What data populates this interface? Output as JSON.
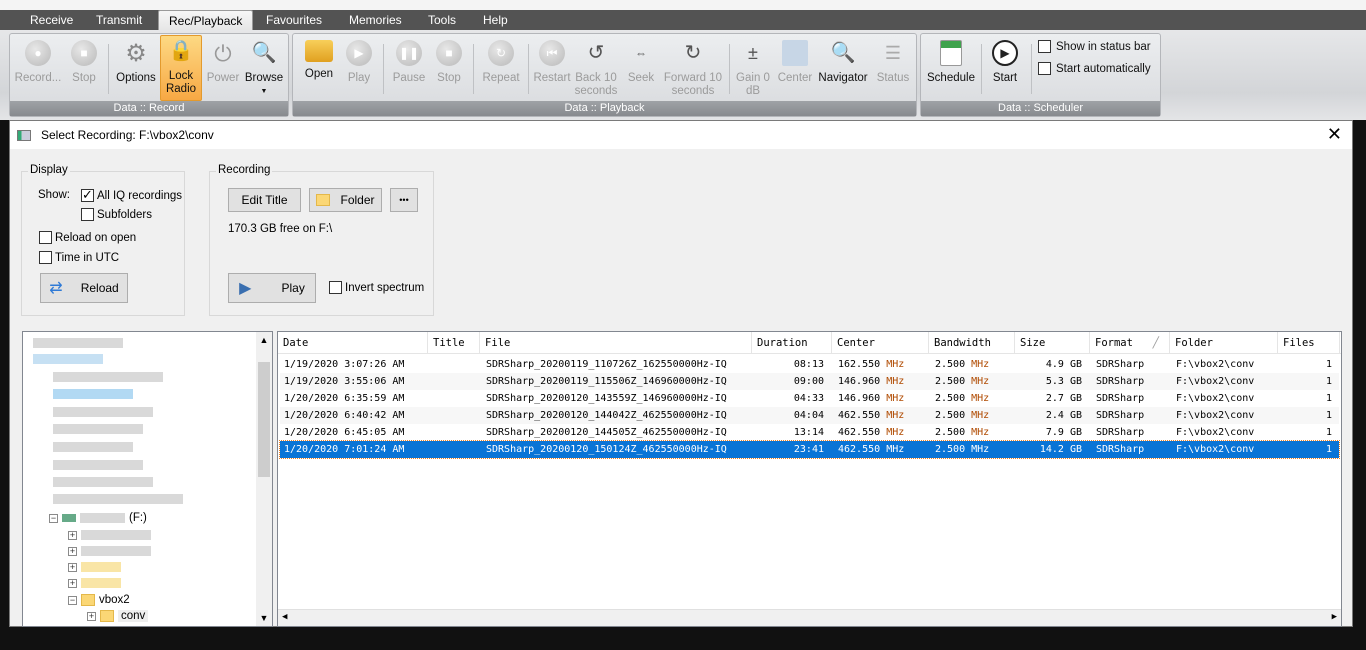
{
  "menu": {
    "tabs": [
      {
        "label": "Receive"
      },
      {
        "label": "Transmit"
      },
      {
        "label": "Rec/Playback",
        "active": true
      },
      {
        "label": "Favourites"
      },
      {
        "label": "Memories"
      },
      {
        "label": "Tools"
      },
      {
        "label": "Help"
      }
    ]
  },
  "ribbon": {
    "record_group": {
      "label": "Data :: Record",
      "buttons": [
        {
          "label": "Record...",
          "icon": "record-icon",
          "enabled": false
        },
        {
          "label": "Stop",
          "icon": "stop-icon",
          "enabled": false
        },
        {
          "label": "Options",
          "icon": "gear-icon",
          "enabled": true
        },
        {
          "label": "Lock Radio",
          "icon": "lock-icon",
          "enabled": true,
          "highlighted": true
        },
        {
          "label": "Power",
          "icon": "power-icon",
          "enabled": false
        },
        {
          "label": "Browse",
          "icon": "browse-icon",
          "enabled": true
        }
      ]
    },
    "playback_group": {
      "label": "Data :: Playback",
      "buttons": [
        {
          "label": "Open",
          "icon": "folder-icon",
          "enabled": true
        },
        {
          "label": "Play",
          "icon": "play-icon",
          "enabled": false
        },
        {
          "label": "Pause",
          "icon": "pause-icon",
          "enabled": false
        },
        {
          "label": "Stop",
          "icon": "stop-icon",
          "enabled": false
        },
        {
          "label": "Repeat",
          "icon": "repeat-icon",
          "enabled": false
        },
        {
          "label": "Restart",
          "icon": "restart-icon",
          "enabled": false
        },
        {
          "label": "Back 10 seconds",
          "icon": "back-icon",
          "enabled": false
        },
        {
          "label": "Seek",
          "icon": "seek-icon",
          "enabled": false
        },
        {
          "label": "Forward 10 seconds",
          "icon": "forward-icon",
          "enabled": false
        },
        {
          "label": "Gain 0 dB",
          "icon": "gain-icon",
          "enabled": false
        },
        {
          "label": "Center",
          "icon": "center-icon",
          "enabled": false
        },
        {
          "label": "Navigator",
          "icon": "magnifier-icon",
          "enabled": true
        },
        {
          "label": "Status",
          "icon": "status-icon",
          "enabled": false
        }
      ]
    },
    "scheduler_group": {
      "label": "Data :: Scheduler",
      "buttons": [
        {
          "label": "Schedule",
          "icon": "calendar-icon",
          "enabled": true
        },
        {
          "label": "Start",
          "icon": "play-circle-icon",
          "enabled": true
        }
      ],
      "show_in_status_bar": "Show in status bar",
      "start_automatically": "Start automatically"
    }
  },
  "dialog": {
    "title": "Select Recording: F:\\vbox2\\conv",
    "display": {
      "legend": "Display",
      "show_label": "Show:",
      "all_iq": "All IQ recordings",
      "all_iq_checked": true,
      "subfolders": "Subfolders",
      "reload_on_open": "Reload on open",
      "time_in_utc": "Time in UTC",
      "reload_button": "Reload"
    },
    "recording": {
      "legend": "Recording",
      "edit_title": "Edit Title",
      "folder": "Folder",
      "more": "•••",
      "free_space": "170.3 GB free on F:\\",
      "play": "Play",
      "invert_spectrum": "Invert spectrum"
    },
    "tree": {
      "drive": "(F:)",
      "folder": "vbox2",
      "subfolder": "conv"
    },
    "table": {
      "columns": [
        "Date",
        "Title",
        "File",
        "Duration",
        "Center",
        "Bandwidth",
        "Size",
        "Format",
        "Folder",
        "Files"
      ],
      "sort_column": "Format",
      "rows": [
        {
          "date": "1/19/2020 3:07:26 AM",
          "title": "",
          "file": "SDRSharp_20200119_110726Z_162550000Hz-IQ",
          "duration": "08:13",
          "center": "162.550",
          "bandwidth": "2.500",
          "size": "4.9 GB",
          "format": "SDRSharp",
          "folder": "F:\\vbox2\\conv",
          "files": "1"
        },
        {
          "date": "1/19/2020 3:55:06 AM",
          "title": "",
          "file": "SDRSharp_20200119_115506Z_146960000Hz-IQ",
          "duration": "09:00",
          "center": "146.960",
          "bandwidth": "2.500",
          "size": "5.3 GB",
          "format": "SDRSharp",
          "folder": "F:\\vbox2\\conv",
          "files": "1"
        },
        {
          "date": "1/20/2020 6:35:59 AM",
          "title": "",
          "file": "SDRSharp_20200120_143559Z_146960000Hz-IQ",
          "duration": "04:33",
          "center": "146.960",
          "bandwidth": "2.500",
          "size": "2.7 GB",
          "format": "SDRSharp",
          "folder": "F:\\vbox2\\conv",
          "files": "1"
        },
        {
          "date": "1/20/2020 6:40:42 AM",
          "title": "",
          "file": "SDRSharp_20200120_144042Z_462550000Hz-IQ",
          "duration": "04:04",
          "center": "462.550",
          "bandwidth": "2.500",
          "size": "2.4 GB",
          "format": "SDRSharp",
          "folder": "F:\\vbox2\\conv",
          "files": "1"
        },
        {
          "date": "1/20/2020 6:45:05 AM",
          "title": "",
          "file": "SDRSharp_20200120_144505Z_462550000Hz-IQ",
          "duration": "13:14",
          "center": "462.550",
          "bandwidth": "2.500",
          "size": "7.9 GB",
          "format": "SDRSharp",
          "folder": "F:\\vbox2\\conv",
          "files": "1"
        },
        {
          "date": "1/20/2020 7:01:24 AM",
          "title": "",
          "file": "SDRSharp_20200120_150124Z_462550000Hz-IQ",
          "duration": "23:41",
          "center": "462.550",
          "bandwidth": "2.500",
          "size": "14.2 GB",
          "format": "SDRSharp",
          "folder": "F:\\vbox2\\conv",
          "files": "1",
          "selected": true
        }
      ],
      "unit": "MHz"
    }
  },
  "colors": {
    "selection": "#0a74d6",
    "highlight": "#f7a844",
    "unit": "#b04a00"
  }
}
